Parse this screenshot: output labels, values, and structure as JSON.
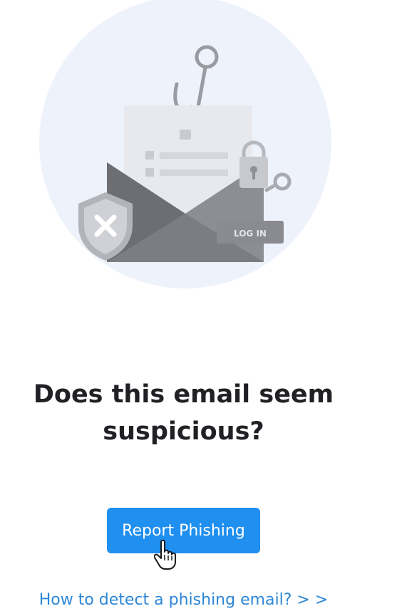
{
  "illustration": {
    "login_label": "LOG IN"
  },
  "prompt": {
    "heading_line1": "Does this email seem",
    "heading_line2": "suspicious?"
  },
  "actions": {
    "report_label": "Report Phishing",
    "help_link_label": "How to detect a phishing email? > >"
  },
  "colors": {
    "primary": "#1f8ff0",
    "link": "#2d86d6",
    "heading": "#202124",
    "illustration_bg": "#eef2fb"
  }
}
